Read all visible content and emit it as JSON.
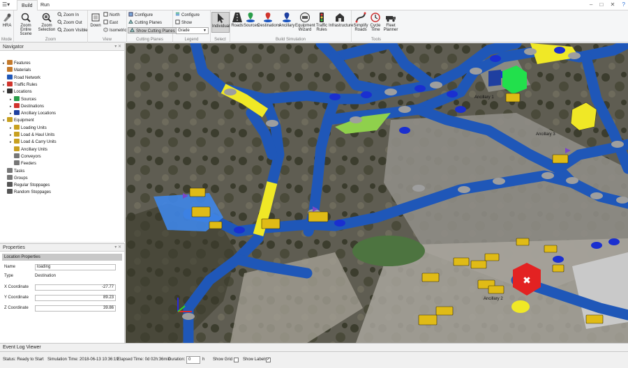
{
  "tabs": {
    "build": "Build",
    "run": "Run"
  },
  "window": {
    "minimize": "–",
    "maximize": "□",
    "close": "✕",
    "help": "?"
  },
  "ribbon": {
    "mode": {
      "hra": "HRA",
      "label": "Mode"
    },
    "zoom": {
      "entire_scene": "Zoom Entire Scene",
      "selection": "Zoom Selection",
      "zoom_in": "Zoom In",
      "zoom_out": "Zoom Out",
      "zoom_visible": "Zoom Visible",
      "label": "Zoom"
    },
    "view": {
      "down": "Down",
      "north": "North",
      "east": "East",
      "isometric": "Isometric",
      "label": "View"
    },
    "cutting": {
      "configure": "Configure",
      "cutting_planes": "Cutting Planes",
      "show_cutting_planes": "Show Cutting Planes",
      "label": "Cutting Planes"
    },
    "legend": {
      "configure": "Configure",
      "show": "Show",
      "selected": "Grade",
      "label": "Legend"
    },
    "select": {
      "individual": "Individual",
      "label": "Select"
    },
    "build_sim": {
      "roads": "Roads",
      "sources": "Sources",
      "destinations": "Destinations",
      "ancillary": "Ancillary",
      "equipment_wizard": "Equipment Wizard",
      "traffic_rules": "Traffic Rules",
      "infrastructure": "Infrastructure",
      "label": "Build Simulation"
    },
    "tools": {
      "simplify_roads": "Simplify Roads",
      "cycle_time": "Cycle Time",
      "fleet_planner": "Fleet Planner",
      "label": "Tools"
    }
  },
  "navigator": {
    "title": "Navigator",
    "items": [
      {
        "label": "Features",
        "arrow": "▸"
      },
      {
        "label": "Materials",
        "arrow": ""
      },
      {
        "label": "Road Network",
        "arrow": ""
      },
      {
        "label": "Traffic Rules",
        "arrow": "▸"
      },
      {
        "label": "Locations",
        "arrow": "▾"
      },
      {
        "label": "Sources",
        "arrow": "▸"
      },
      {
        "label": "Destinations",
        "arrow": "▸"
      },
      {
        "label": "Ancillary Locations",
        "arrow": "▸"
      },
      {
        "label": "Equipment",
        "arrow": "▾"
      },
      {
        "label": "Loading Units",
        "arrow": "▸"
      },
      {
        "label": "Load & Haul Units",
        "arrow": "▸"
      },
      {
        "label": "Load & Carry Units",
        "arrow": "▸"
      },
      {
        "label": "Ancillary Units",
        "arrow": ""
      },
      {
        "label": "Conveyors",
        "arrow": ""
      },
      {
        "label": "Feeders",
        "arrow": ""
      },
      {
        "label": "Tasks",
        "arrow": ""
      },
      {
        "label": "Groups",
        "arrow": ""
      },
      {
        "label": "Regular Stoppages",
        "arrow": ""
      },
      {
        "label": "Random Stoppages",
        "arrow": ""
      }
    ]
  },
  "properties": {
    "title": "Properties",
    "section": "Location Properties",
    "name_label": "Name",
    "name_value": "loading",
    "type_label": "Type",
    "type_value": "Destination",
    "x_label": "X Coordinate",
    "x_value": "-27.77",
    "y_label": "Y Coordinate",
    "y_value": "89.23",
    "z_label": "Z Coordinate",
    "z_value": "39.86"
  },
  "viewport": {
    "labels": {
      "ancillary_1": "Ancillary 1",
      "ancillary_3": "Ancillary 3",
      "ancillary_2": "Ancillary 2"
    }
  },
  "eventlog": {
    "title": "Event Log Viewer"
  },
  "status": {
    "status": "Status: Ready to Start",
    "sim_time": "Simulation Time: 2018-06-13 10:36:19",
    "elapsed": "Elapsed Time: 0d 02h:36min",
    "duration_label": "Duration:",
    "duration_value": "0",
    "duration_unit": "h",
    "show_grid": "Show Grid",
    "show_labels": "Show Labels",
    "show_labels_checked": "✓"
  },
  "colors": {
    "road": "#1f57b8",
    "road_node": "#9e9e9e",
    "node_blue": "#1a2fd0",
    "yellow": "#f0e826",
    "green": "#8fd04c",
    "source_blue": "#3f86e8",
    "ribbon_bg": "#f5f6f7"
  }
}
